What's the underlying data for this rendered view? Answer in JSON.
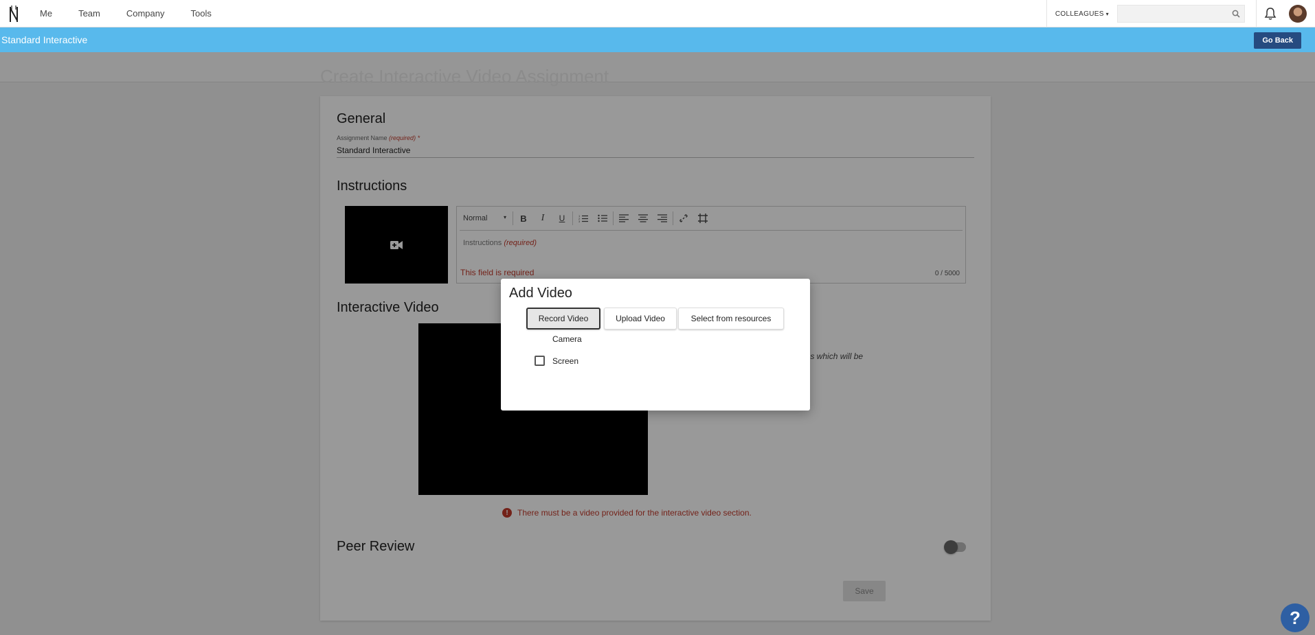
{
  "nav": {
    "links": [
      "Me",
      "Team",
      "Company",
      "Tools"
    ],
    "colleagues_label": "COLLEAGUES",
    "search_placeholder": ""
  },
  "titlebar": {
    "title": "Standard Interactive",
    "go_back_label": "Go Back"
  },
  "page": {
    "heading": "Create Interactive Video Assignment"
  },
  "general": {
    "heading": "General",
    "name_label": "Assignment Name",
    "required_tag": "(required)",
    "required_star": "*",
    "name_value": "Standard Interactive"
  },
  "instructions": {
    "heading": "Instructions",
    "format_select": "Normal",
    "placeholder": "Instructions",
    "required_tag": "(required)",
    "error": "This field is required",
    "counter": "0 / 5000"
  },
  "interactive_video": {
    "heading": "Interactive Video",
    "description_fragment": "ons which will be",
    "error": "There must be a video provided for the interactive video section."
  },
  "peer_review": {
    "heading": "Peer Review",
    "toggle_on": false
  },
  "save_label": "Save",
  "modal": {
    "title": "Add Video",
    "buttons": [
      "Record Video",
      "Upload Video",
      "Select from resources"
    ],
    "active_button": "Record Video",
    "options": [
      {
        "label": "Camera",
        "checkbox": false
      },
      {
        "label": "Screen",
        "checkbox": true,
        "checked": false
      }
    ]
  },
  "help_label": "?",
  "colors": {
    "titlebar": "#58b9ec",
    "go_back": "#264b80",
    "error": "#c0392b",
    "help": "#2e5fa3"
  }
}
